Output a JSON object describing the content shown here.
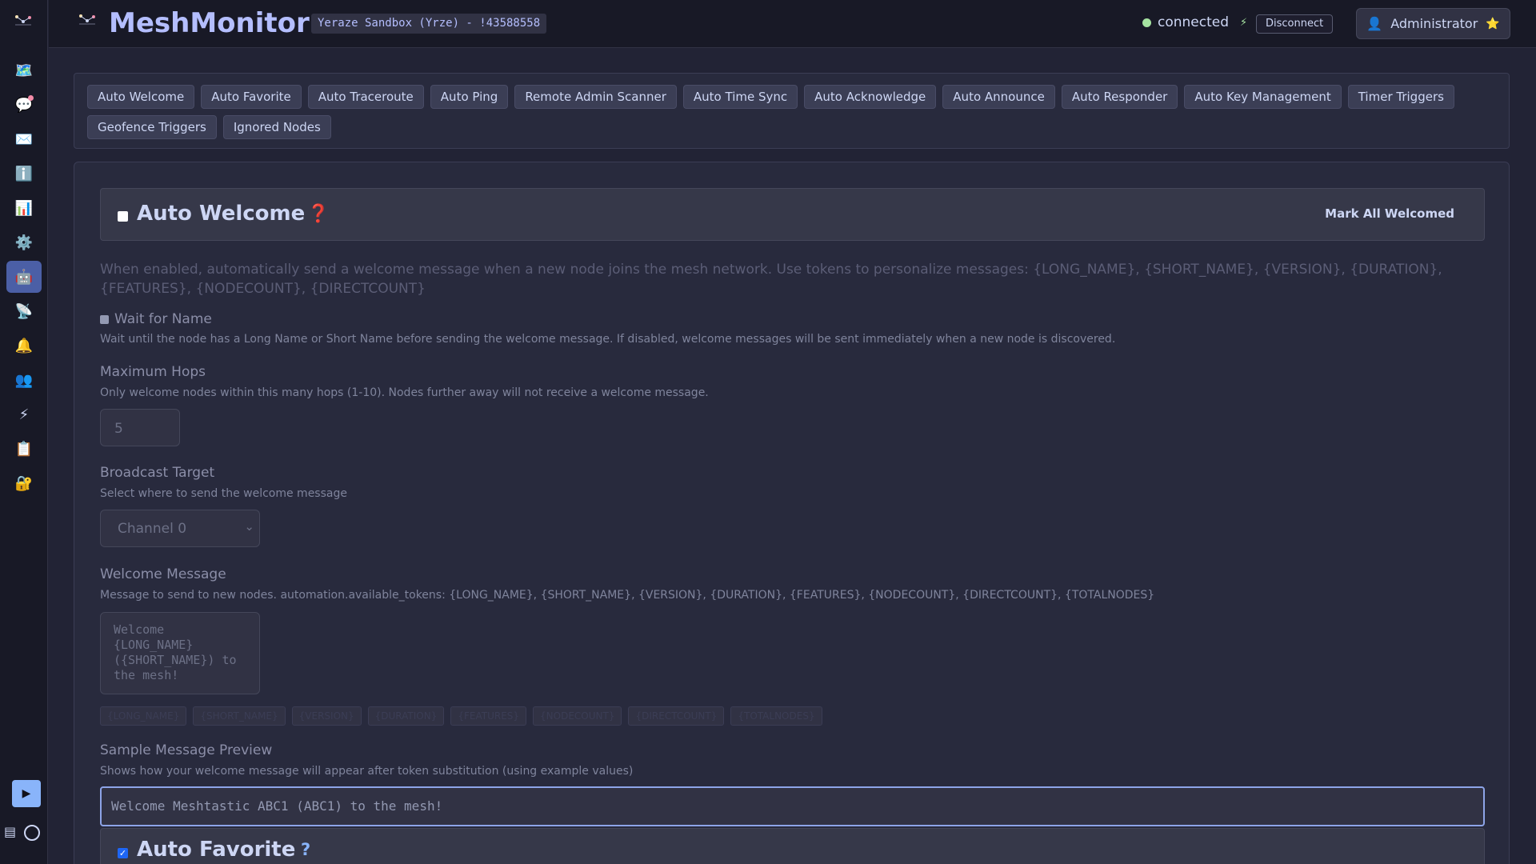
{
  "sidebar": {
    "logo_icon": "mesh-logo-icon",
    "items": [
      {
        "name": "map",
        "icon": "🗺️"
      },
      {
        "name": "chat",
        "icon": "💬",
        "badge": true
      },
      {
        "name": "messages",
        "icon": "✉️"
      },
      {
        "name": "info",
        "icon": "ℹ️"
      },
      {
        "name": "dashboard",
        "icon": "📊"
      },
      {
        "name": "settings",
        "icon": "⚙️"
      },
      {
        "name": "automation",
        "icon": "🤖",
        "active": true
      },
      {
        "name": "device",
        "icon": "📡"
      },
      {
        "name": "notifications",
        "icon": "🔔"
      },
      {
        "name": "users",
        "icon": "👥"
      },
      {
        "name": "power",
        "icon": "⚡"
      },
      {
        "name": "audit-log",
        "icon": "📋"
      },
      {
        "name": "security",
        "icon": "🔐"
      }
    ],
    "play_icon": "▶",
    "docs_icon": "▤"
  },
  "header": {
    "title": "MeshMonitor",
    "node": "Yeraze Sandbox (Yrze) - !43588558",
    "status": "connected",
    "bolt": "⚡",
    "disconnect": "Disconnect",
    "user": "Administrator",
    "user_icon": "👤",
    "star": "⭐"
  },
  "tabs": [
    "Auto Welcome",
    "Auto Favorite",
    "Auto Traceroute",
    "Auto Ping",
    "Remote Admin Scanner",
    "Auto Time Sync",
    "Auto Acknowledge",
    "Auto Announce",
    "Auto Responder",
    "Auto Key Management",
    "Timer Triggers",
    "Geofence Triggers",
    "Ignored Nodes"
  ],
  "welcome": {
    "title": "Auto Welcome",
    "help": "❓",
    "mark_all": "Mark All Welcomed",
    "description": "When enabled, automatically send a welcome message when a new node joins the mesh network. Use tokens to personalize messages: {LONG_NAME}, {SHORT_NAME}, {VERSION}, {DURATION}, {FEATURES}, {NODECOUNT}, {DIRECTCOUNT}",
    "wait_label": "Wait for Name",
    "wait_hint": "Wait until the node has a Long Name or Short Name before sending the welcome message. If disabled, welcome messages will be sent immediately when a new node is discovered.",
    "hops_label": "Maximum Hops",
    "hops_hint": "Only welcome nodes within this many hops (1-10). Nodes further away will not receive a welcome message.",
    "hops_value": "5",
    "target_label": "Broadcast Target",
    "target_hint": "Select where to send the welcome message",
    "target_value": "Channel 0",
    "message_label": "Welcome Message",
    "message_hint": "Message to send to new nodes. automation.available_tokens: {LONG_NAME}, {SHORT_NAME}, {VERSION}, {DURATION}, {FEATURES}, {NODECOUNT}, {DIRECTCOUNT}, {TOTALNODES}",
    "message_value": "Welcome\n{LONG_NAME}\n({SHORT_NAME}) to\nthe mesh!",
    "tokens": [
      "{LONG_NAME}",
      "{SHORT_NAME}",
      "{VERSION}",
      "{DURATION}",
      "{FEATURES}",
      "{NODECOUNT}",
      "{DIRECTCOUNT}",
      "{TOTALNODES}"
    ],
    "preview_label": "Sample Message Preview",
    "preview_hint": "Shows how your welcome message will appear after token substitution (using example values)",
    "preview_value": "Welcome Meshtastic ABC1 (ABC1) to the mesh!"
  },
  "favorite": {
    "title": "Auto Favorite",
    "help": "?"
  }
}
